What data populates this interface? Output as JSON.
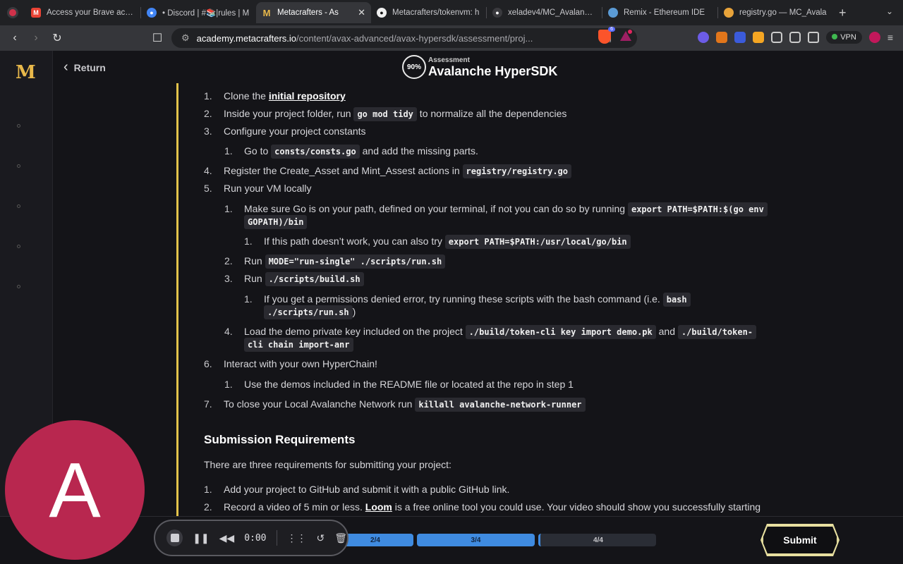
{
  "browser": {
    "tabs": [
      {
        "title": "Access your Brave accou",
        "favicon": "gmail-icon",
        "color": "#ea4335",
        "active": false
      },
      {
        "title": "• Discord | #📚|rules | M",
        "favicon": "chrome-icon",
        "color": "#4285f4",
        "active": false
      },
      {
        "title": "Metacrafters - As",
        "favicon": "metacrafters-icon",
        "color": "#e8b84a",
        "active": true
      },
      {
        "title": "Metacrafters/tokenvm: h",
        "favicon": "github-icon",
        "color": "#f0f0f0",
        "active": false
      },
      {
        "title": "xeladev4/MC_Avalanche",
        "favicon": "github-icon",
        "color": "#f0f0f0",
        "active": false
      },
      {
        "title": "Remix - Ethereum IDE",
        "favicon": "remix-icon",
        "color": "#5b9bd5",
        "active": false
      },
      {
        "title": "registry.go — MC_Avala",
        "favicon": "gitbook-icon",
        "color": "#e8a33a",
        "active": false
      }
    ],
    "url_host": "academy.metacrafters.io",
    "url_path": "/content/avax-advanced/avax-hypersdk/assessment/proj...",
    "vpn_label": "VPN",
    "shield_count": "6",
    "bat_count": "1"
  },
  "site": {
    "logo": "M",
    "return_label": "Return",
    "progress_badge": "90%",
    "assessment_label": "Assessment",
    "assessment_title": "Avalanche HyperSDK"
  },
  "steps": {
    "s1_num": "1.",
    "s1_text": "Clone the ",
    "s1_link": "initial repository",
    "s2_num": "2.",
    "s2_pre": "Inside your project folder, run ",
    "s2_code": "go mod tidy",
    "s2_post": " to normalize all the dependencies",
    "s3_num": "3.",
    "s3_text": "Configure your project constants",
    "s3a_num": "1.",
    "s3a_pre": "Go to ",
    "s3a_code": "consts/consts.go",
    "s3a_post": " and add the missing parts.",
    "s4_num": "4.",
    "s4_pre": "Register the Create_Asset and Mint_Assest actions in ",
    "s4_code": "registry/registry.go",
    "s5_num": "5.",
    "s5_text": "Run your VM locally",
    "s5a_num": "1.",
    "s5a_pre": "Make sure Go is on your path, defined on your terminal, if not you can do so by running ",
    "s5a_code1": "export PATH=$PATH:$(go env",
    "s5a_code2": "GOPATH)/bin",
    "s5a1_num": "1.",
    "s5a1_pre": "If this path doesn’t work, you can also try ",
    "s5a1_code": "export PATH=$PATH:/usr/local/go/bin",
    "s5b_num": "2.",
    "s5b_pre": "Run ",
    "s5b_code": "MODE=\"run-single\" ./scripts/run.sh",
    "s5c_num": "3.",
    "s5c_pre": "Run ",
    "s5c_code": "./scripts/build.sh",
    "s5c1_num": "1.",
    "s5c1_pre": "If you get a permissions denied error, try running these scripts with the bash command (i.e. ",
    "s5c1_code1": "bash",
    "s5c1_code2": "./scripts/run.sh",
    "s5c1_post": ")",
    "s5d_num": "4.",
    "s5d_pre": "Load the demo private key included on the project ",
    "s5d_code1": "./build/token-cli key import demo.pk",
    "s5d_mid": " and ",
    "s5d_code2": "./build/token-",
    "s5d_code3": "cli chain import-anr",
    "s6_num": "6.",
    "s6_text": "Interact with your own HyperChain!",
    "s6a_num": "1.",
    "s6a_text": "Use the demos included in the README file or located at the repo in step 1",
    "s7_num": "7.",
    "s7_pre": "To close your Local Avalanche Network run ",
    "s7_code": "killall avalanche-network-runner"
  },
  "submission": {
    "heading": "Submission Requirements",
    "intro": "There are three requirements for submitting your project:",
    "r1_num": "1.",
    "r1_text": "Add your project to GitHub and submit it with a public GitHub link.",
    "r2_num": "2.",
    "r2_pre": "Record a video of 5 min or less. ",
    "r2_link": "Loom",
    "r2_post": " is a free online tool you could use. Your video should show you successfully starting"
  },
  "footer": {
    "progress_steps": [
      {
        "label": "2/4",
        "state": "done"
      },
      {
        "label": "3/4",
        "state": "done"
      },
      {
        "label": "4/4",
        "state": "todo"
      }
    ],
    "submit_label": "Submit"
  },
  "recorder": {
    "time": "0:00"
  },
  "avatar": {
    "initial": "A",
    "color": "#b8274f"
  }
}
